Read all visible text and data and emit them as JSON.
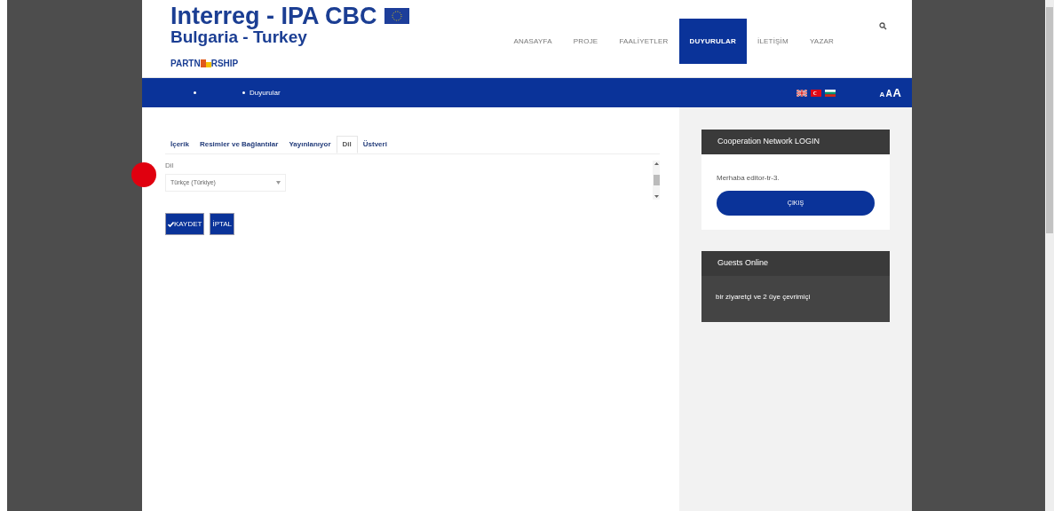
{
  "logo": {
    "title": "Interreg - IPA CBC",
    "subtitle": "Bulgaria - Turkey",
    "tagline_start": "PARTN",
    "tagline_end": "RSHIP"
  },
  "nav": [
    {
      "label": "ANASAYFA",
      "selected": false
    },
    {
      "label": "PROJE",
      "selected": false
    },
    {
      "label": "FAALİYETLER",
      "selected": false
    },
    {
      "label": "DUYURULAR",
      "selected": true
    },
    {
      "label": "İLETİŞİM",
      "selected": false
    },
    {
      "label": "YAZAR",
      "selected": false
    }
  ],
  "breadcrumb": [
    "Duyurular"
  ],
  "font_sizes": [
    "A",
    "A",
    "A"
  ],
  "tabs": [
    {
      "label": "İçerik",
      "selected": false
    },
    {
      "label": "Resimler ve Bağlantılar",
      "selected": false
    },
    {
      "label": "Yayınlanıyor",
      "selected": false
    },
    {
      "label": "Dil",
      "selected": true
    },
    {
      "label": "Üstveri",
      "selected": false
    }
  ],
  "field": {
    "label": "Dil",
    "value": "Türkçe (Türkiye)"
  },
  "buttons": [
    {
      "label": "KAYDET",
      "kind": "save"
    },
    {
      "label": "İPTAL",
      "kind": "cancel"
    }
  ],
  "login": {
    "title": "Cooperation Network LOGIN",
    "greeting": "Merhaba editor-tr-3.",
    "button": "ÇIKIŞ"
  },
  "guests": {
    "title": "Guests Online",
    "text": "bir ziyaretçi ve 2 üye çevrimiçi"
  }
}
